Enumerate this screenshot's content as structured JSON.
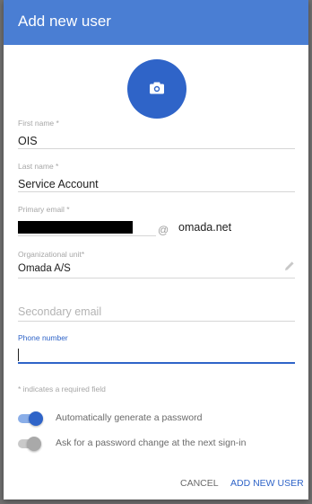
{
  "dialog": {
    "title": "Add new user"
  },
  "avatar": {
    "icon": "camera-icon"
  },
  "form": {
    "first_name": {
      "label": "First name *",
      "value": "OIS"
    },
    "last_name": {
      "label": "Last name *",
      "value": "Service Account"
    },
    "primary_email": {
      "label": "Primary email *",
      "at": "@",
      "domain": "omada.net"
    },
    "org_unit": {
      "label": "Organizational unit*",
      "value": "Omada A/S",
      "icon": "pencil-icon"
    },
    "secondary_email": {
      "placeholder": "Secondary email"
    },
    "phone": {
      "label": "Phone number",
      "value": ""
    }
  },
  "required_note": "* indicates a required field",
  "toggles": {
    "auto_password": {
      "label": "Automatically generate a password",
      "on": true
    },
    "password_change": {
      "label": "Ask for a password change at the next sign-in",
      "on": true
    }
  },
  "actions": {
    "cancel": "CANCEL",
    "add": "ADD NEW USER"
  },
  "colors": {
    "accent": "#2f64c8",
    "header": "#4a7ed3"
  }
}
